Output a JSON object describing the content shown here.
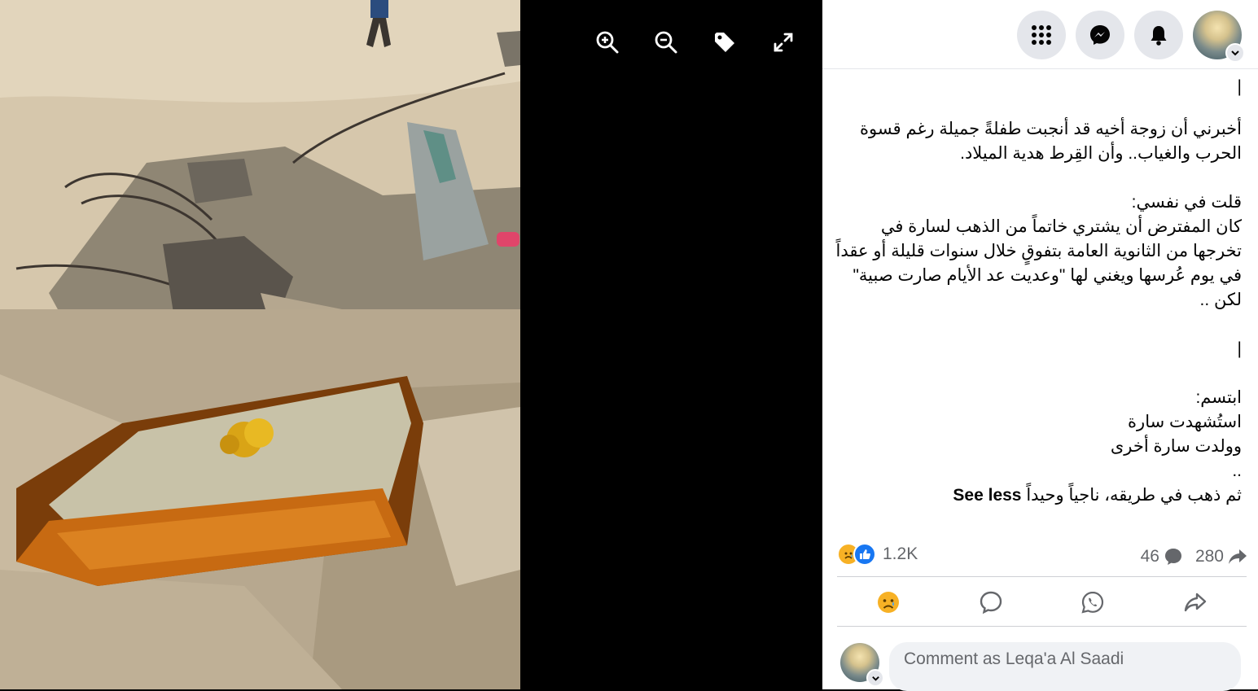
{
  "viewer": {
    "icons": [
      "zoom-in-icon",
      "zoom-out-icon",
      "tag-icon",
      "fullscreen-icon"
    ]
  },
  "topbar": {
    "icons": [
      "menu-grid-icon",
      "messenger-icon",
      "notifications-bell-icon"
    ],
    "account": "profile-avatar"
  },
  "post": {
    "line_marker_1": "|",
    "paragraph_1": "أخبرني أن زوجة أخيه قد أنجبت طفلةً جميلة رغم قسوة الحرب والغياب.. وأن القِرط هدية الميلاد.",
    "paragraph_2": "قلت في نفسي:\nكان المفترض أن يشتري خاتماً من الذهب لسارة في تخرجها من الثانوية العامة بتفوقٍ خلال سنوات قليلة أو عقداً في يوم عُرسها ويغني لها \"وعديت عد الأيام صارت صبية\" لكن ..",
    "line_marker_2": "|",
    "paragraph_3": "ابتسم:\nاستُشهدت سارة\nوولدت سارة أخرى\n..",
    "last_line": "ثم ذهب في طريقه، ناجياً وحيداً",
    "see_less": "See less"
  },
  "stats": {
    "reactions_count": "1.2K",
    "comments_count": "46",
    "shares_count": "280"
  },
  "comment": {
    "placeholder": "Comment as Leqa'a Al Saadi"
  },
  "colors": {
    "accent": "#1877f2",
    "sad_react": "#f7b125",
    "muted_text": "#65676b"
  }
}
